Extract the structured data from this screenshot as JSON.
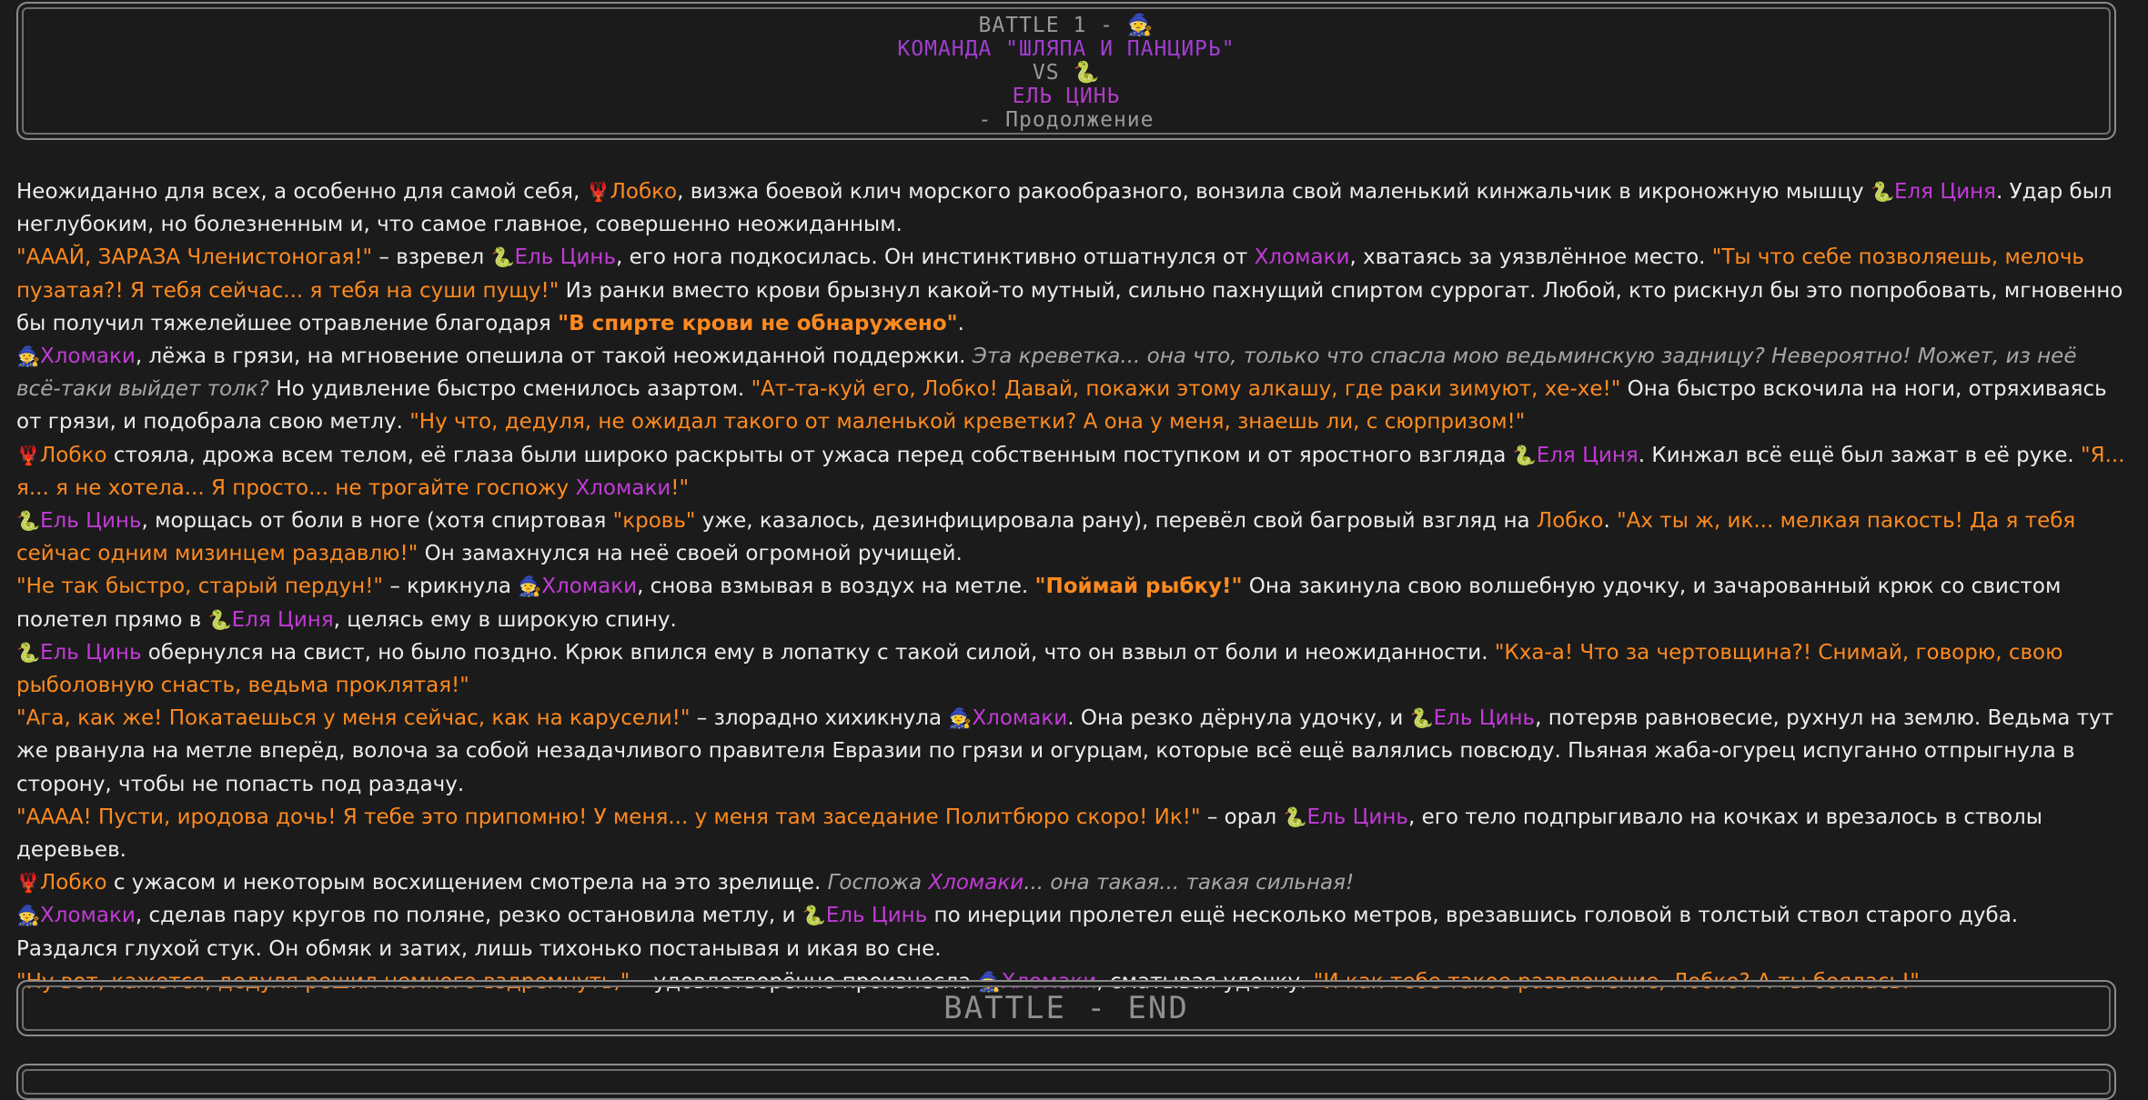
{
  "header": {
    "battle_line": "BATTLE 1 - ",
    "team_name": "КОМАНДА \"ШЛЯПА И ПАНЦИРЬ\"",
    "vs": "VS ",
    "opponent": "ЕЛЬ ЦИНЬ",
    "continuation": "- Продолжение"
  },
  "icons": {
    "witch": "🧙",
    "shrimp": "🦞",
    "snake": "🐍"
  },
  "colors": {
    "speech": "#ff8a1f",
    "name": "#c13bd6",
    "header_purple": "#a13fd1",
    "border": "#8a8a8a"
  },
  "story": {
    "p1": {
      "a": "Неожиданно для всех, а особенно для самой себя, ",
      "n1": "Лобко",
      "b": ", визжа боевой клич морского ракообразного, вонзила свой маленький кинжальчик в икроножную мышцу ",
      "n2": "Еля Циня",
      "c": ". Удар был неглубоким, но болезненным и, что самое главное, совершенно неожиданным."
    },
    "p2": {
      "q1": "\"АААЙ, ЗАРАЗА Членистоногая!\"",
      "a": " – взревел ",
      "n1": "Ель Цинь",
      "b": ", его нога подкосилась. Он инстинктивно отшатнулся от ",
      "n2": "Хломаки",
      "c": ", хватаясь за уязвлённое место. ",
      "q2": "\"Ты что себе позволяешь, мелочь пузатая?! Я тебя сейчас... я тебя на суши пущу!\"",
      "d": " Из ранки вместо крови брызнул какой-то мутный, сильно пахнущий спиртом суррогат. Любой, кто рискнул бы это попробовать, мгновенно бы получил тяжелейшее отравление благодаря ",
      "q3": "\"В спирте крови не обнаружено\"",
      "e": "."
    },
    "p3": {
      "n1": "Хломаки",
      "a": ", лёжа в грязи, на мгновение опешила от такой неожиданной поддержки. ",
      "t": "Эта креветка... она что, только что спасла мою ведьминскую задницу? Невероятно! Может, из неё всё-таки выйдет толк?",
      "b": " Но удивление быстро сменилось азартом. ",
      "q1": "\"Ат-та-куй его, Лобко! Давай, покажи этому алкашу, где раки зимуют, хе-хе!\"",
      "c": " Она быстро вскочила на ноги, отряхиваясь от грязи, и подобрала свою метлу. ",
      "q2": "\"Ну что, дедуля, не ожидал такого от маленькой креветки? А она у меня, знаешь ли, с сюрпризом!\""
    },
    "p4": {
      "n1": "Лобко",
      "a": " стояла, дрожа всем телом, её глаза были широко раскрыты от ужаса перед собственным поступком и от яростного взгляда ",
      "n2": "Еля Циня",
      "b": ". Кинжал всё ещё был зажат в её руке. ",
      "q1": "\"Я... я... я не хотела... Я просто... не трогайте госпожу ",
      "n3": "Хломаки",
      "q2": "!\""
    },
    "p5": {
      "n1": "Ель Цинь",
      "a": ", морщась от боли в ноге (хотя спиртовая ",
      "q1": "\"кровь\"",
      "b": " уже, казалось, дезинфицировала рану), перевёл свой багровый взгляд на ",
      "n2": "Лобко",
      "c": ". ",
      "q2": "\"Ах ты ж, ик... мелкая пакость! Да я тебя сейчас одним мизинцем раздавлю!\"",
      "d": " Он замахнулся на неё своей огромной ручищей."
    },
    "p6": {
      "q1": "\"Не так быстро, старый пердун!\"",
      "a": " – крикнула ",
      "n1": "Хломаки",
      "b": ", снова взмывая в воздух на метле. ",
      "q2": "\"Поймай рыбку!\"",
      "c": " Она закинула свою волшебную удочку, и зачарованный крюк со свистом полетел прямо в ",
      "n2": "Еля Циня",
      "d": ", целясь ему в широкую спину."
    },
    "p7": {
      "n1": "Ель Цинь",
      "a": " обернулся на свист, но было поздно. Крюк впился ему в лопатку с такой силой, что он взвыл от боли и неожиданности. ",
      "q1": "\"Кха-а! Что за чертовщина?! Снимай, говорю, свою рыболовную снасть, ведьма проклятая!\""
    },
    "p8": {
      "q1": "\"Ага, как же! Покатаешься у меня сейчас, как на карусели!\"",
      "a": " – злорадно хихикнула ",
      "n1": "Хломаки",
      "b": ". Она резко дёрнула удочку, и ",
      "n2": "Ель Цинь",
      "c": ", потеряв равновесие, рухнул на землю. Ведьма тут же рванула на метле вперёд, волоча за собой незадачливого правителя Евразии по грязи и огурцам, которые всё ещё валялись повсюду. Пьяная жаба-огурец испуганно отпрыгнула в сторону, чтобы не попасть под раздачу."
    },
    "p9": {
      "q1": "\"АААА! Пусти, иродова дочь! Я тебе это припомню! У меня... у меня там заседание Политбюро скоро! Ик!\"",
      "a": " – орал ",
      "n1": "Ель Цинь",
      "b": ", его тело подпрыгивало на кочках и врезалось в стволы деревьев."
    },
    "p10": {
      "n1": "Лобко",
      "a": " с ужасом и некоторым восхищением смотрела на это зрелище. ",
      "t1": "Госпожа ",
      "n2": "Хломаки",
      "t2": "... она такая... такая сильная!"
    },
    "p11": {
      "n1": "Хломаки",
      "a": ", сделав пару кругов по поляне, резко остановила метлу, и ",
      "n2": "Ель Цинь",
      "b": " по инерции пролетел ещё несколько метров, врезавшись головой в толстый ствол старого дуба. Раздался глухой стук. Он обмяк и затих, лишь тихонько постанывая и икая во сне."
    },
    "p12": {
      "q1": "\"Ну вот, кажется, дедуля решил немного вздремнуть,\"",
      "a": " – удовлетворённо произнесла ",
      "n1": "Хломаки",
      "b": ", сматывая удочку. ",
      "q2": "\"И как тебе такое развлечение, ",
      "n2": "Лобко",
      "q3": "? А ты боялась!\""
    }
  },
  "footer": {
    "end_label": "BATTLE - END"
  }
}
